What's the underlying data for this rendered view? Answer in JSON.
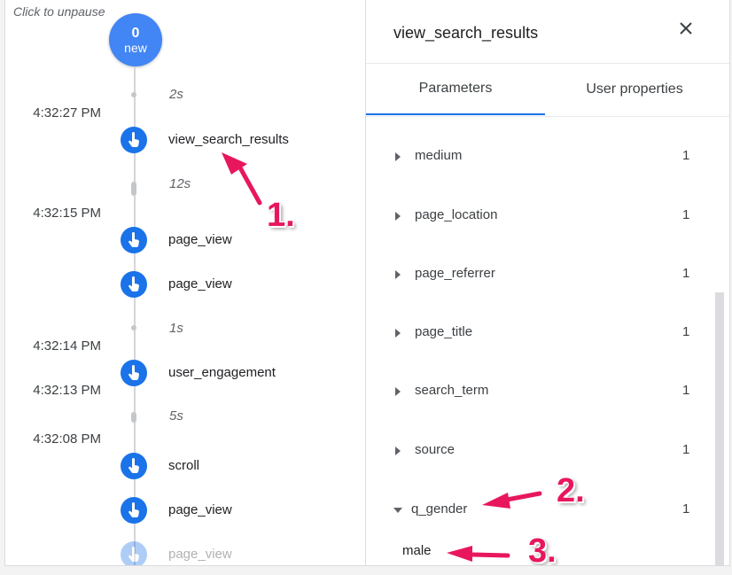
{
  "timeline": {
    "pause_text": "Click to unpause",
    "new_count": "0",
    "new_label": "new",
    "gaps": [
      "2s",
      "12s",
      "1s",
      "5s"
    ],
    "timestamps": [
      "4:32:27 PM",
      "4:32:15 PM",
      "4:32:14 PM",
      "4:32:13 PM",
      "4:32:08 PM"
    ],
    "events": [
      "view_search_results",
      "page_view",
      "page_view",
      "user_engagement",
      "scroll",
      "page_view",
      "page_view"
    ]
  },
  "panel": {
    "title": "view_search_results",
    "tabs": [
      {
        "label": "Parameters",
        "active": true
      },
      {
        "label": "User properties",
        "active": false
      }
    ],
    "params": [
      {
        "name": "medium",
        "count": "1"
      },
      {
        "name": "page_location",
        "count": "1"
      },
      {
        "name": "page_referrer",
        "count": "1"
      },
      {
        "name": "page_title",
        "count": "1"
      },
      {
        "name": "search_term",
        "count": "1"
      },
      {
        "name": "source",
        "count": "1"
      },
      {
        "name": "q_gender",
        "count": "1",
        "expanded": true,
        "value": "male"
      }
    ]
  },
  "annotations": [
    "1.",
    "2.",
    "3."
  ],
  "colors": {
    "accent": "#1a73e8",
    "counter": "#4285f4",
    "annotation": "#e8175d"
  },
  "icons": [
    "close-icon",
    "touch-icon",
    "caret-right-icon",
    "caret-down-icon"
  ]
}
